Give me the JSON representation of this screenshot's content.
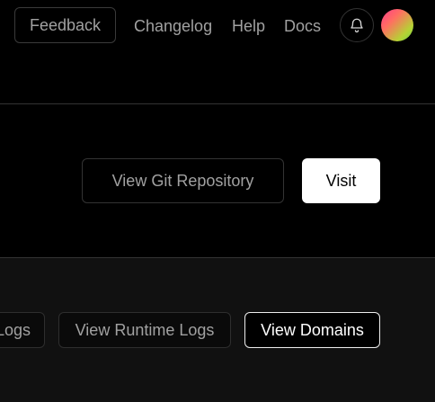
{
  "topnav": {
    "feedback_label": "Feedback",
    "links": {
      "changelog": "Changelog",
      "help": "Help",
      "docs": "Docs"
    },
    "notifications_icon": "bell-icon",
    "avatar_gradient": [
      "#ff3b8a",
      "#b5d334"
    ]
  },
  "project": {
    "git_button_label": "View Git Repository",
    "visit_button_label": "Visit"
  },
  "deployment": {
    "logs_button_label": "Logs",
    "runtime_logs_button_label": "View Runtime Logs",
    "domains_button_label": "View Domains"
  },
  "colors": {
    "background": "#000000",
    "section_background": "#111111",
    "muted_text": "#a1a1a1",
    "border": "#333333",
    "primary_button": "#ffffff"
  }
}
